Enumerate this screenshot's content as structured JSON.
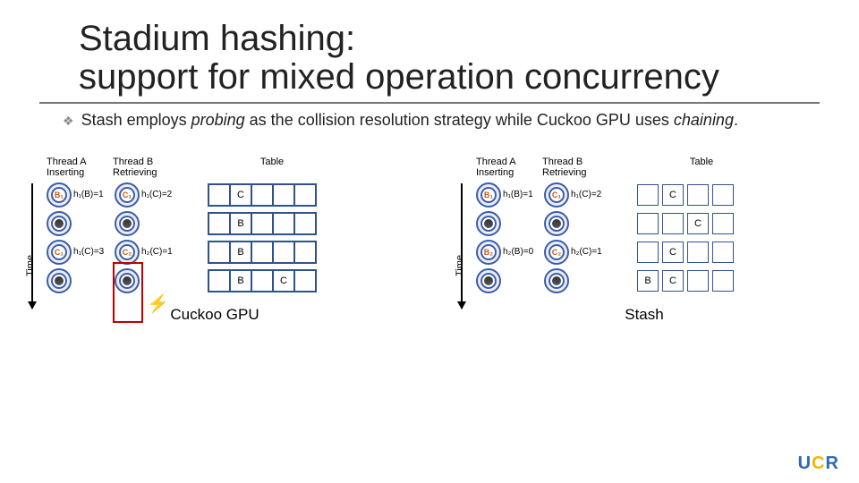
{
  "title_line1": "Stadium hashing:",
  "title_line2": "support for mixed operation concurrency",
  "bullet_prefix": "Stash employs ",
  "bullet_em1": "probing",
  "bullet_mid": " as the collision resolution strategy while Cuckoo GPU uses ",
  "bullet_em2": "chaining",
  "bullet_suffix": ".",
  "labels": {
    "thread_a": "Thread A\nInserting",
    "thread_b": "Thread B\nRetrieving",
    "table": "Table",
    "time": "Time"
  },
  "cuckoo": {
    "rows": [
      {
        "a": "B₁",
        "a_dark": false,
        "ha": "h₁(B)=1",
        "b": "C₁",
        "bb_dark": false,
        "hb": "h₁(C)=2",
        "table": [
          "",
          "C",
          "",
          "",
          ""
        ]
      },
      {
        "a": "",
        "a_dark": true,
        "ha": "",
        "b": "",
        "bb_dark": true,
        "hb": "",
        "table": [
          "",
          "B",
          "",
          "",
          ""
        ]
      },
      {
        "a": "C₁",
        "a_dark": false,
        "ha": "h₁(C)=3",
        "b": "C₂",
        "bb_dark": false,
        "hb": "h₂(C)=1",
        "table": [
          "",
          "B",
          "",
          "",
          ""
        ]
      },
      {
        "a": "",
        "a_dark": true,
        "ha": "",
        "b": "",
        "bb_dark": true,
        "hb": "",
        "table": [
          "",
          "B",
          "",
          "C",
          ""
        ]
      }
    ],
    "sub": "Cuckoo GPU"
  },
  "stash": {
    "rows": [
      {
        "a": "B₁",
        "a_dark": false,
        "ha": "h₁(B)=1",
        "b": "C₁",
        "bb_dark": false,
        "hb": "h₁(C)=2",
        "chain": [
          [
            "",
            "C",
            "",
            ""
          ]
        ]
      },
      {
        "a": "",
        "a_dark": true,
        "ha": "",
        "b": "",
        "bb_dark": true,
        "hb": "",
        "chain": [
          [
            "",
            "",
            "C",
            ""
          ]
        ]
      },
      {
        "a": "B₂",
        "a_dark": false,
        "ha": "h₂(B)=0",
        "b": "C₂",
        "bb_dark": false,
        "hb": "h₂(C)=1",
        "chain": [
          [
            "",
            "C",
            "",
            ""
          ]
        ]
      },
      {
        "a": "",
        "a_dark": true,
        "ha": "",
        "b": "",
        "bb_dark": true,
        "hb": "",
        "chain": [
          [
            "B",
            "C",
            "",
            ""
          ]
        ]
      }
    ],
    "sub": "Stash"
  },
  "logo": {
    "u": "U",
    "c": "C",
    "r": "R"
  }
}
